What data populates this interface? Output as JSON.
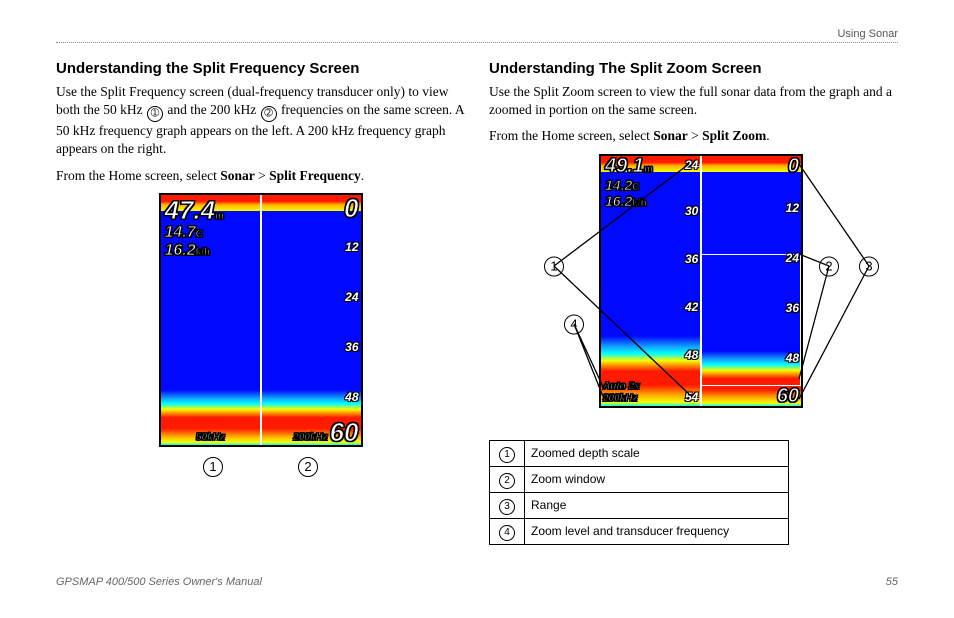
{
  "header_right": "Using Sonar",
  "left": {
    "title": "Understanding the Split Frequency Screen",
    "para_a": "Use the Split Frequency screen (dual-frequency transducer only) to view both the 50 kHz ",
    "para_b": " and the 200 kHz ",
    "para_c": " frequencies on the same screen. A 50 kHz frequency graph appears on the left. A 200 kHz frequency graph appears on the right.",
    "nav_a": "From the Home screen, select ",
    "nav_b": "Sonar",
    "nav_c": " > ",
    "nav_d": "Split Frequency",
    "nav_e": ".",
    "sonar": {
      "depth": "47.4",
      "depth_unit": "m",
      "temp": "14.7",
      "temp_unit": "C",
      "speed": "16.2",
      "speed_unit": "k/h",
      "top_right": "0",
      "ticks_right": [
        "12",
        "24",
        "36",
        "48"
      ],
      "bottom_right": "60",
      "left_freq": "50kHz",
      "right_freq": "200kHz"
    },
    "callouts": [
      "1",
      "2"
    ]
  },
  "right": {
    "title": "Understanding The Split Zoom Screen",
    "para": "Use the Split Zoom screen to view the full sonar data from the graph and a zoomed in portion on the same screen.",
    "nav_a": "From the Home screen, select ",
    "nav_b": "Sonar",
    "nav_c": " > ",
    "nav_d": "Split Zoom",
    "nav_e": ".",
    "sonar": {
      "depth": "49.1",
      "depth_unit": "m",
      "temp": "14.2",
      "temp_unit": "C",
      "speed": "16.2",
      "speed_unit": "k/h",
      "top_left_tick": "24",
      "top_right": "0",
      "ticks_left": [
        "30",
        "36",
        "42",
        "48"
      ],
      "ticks_right": [
        "12",
        "24",
        "36",
        "48"
      ],
      "left_bottom_tick": "54",
      "right_bottom": "60",
      "zoom_label_a": "Auto 2x",
      "zoom_label_b": "200kHz"
    },
    "callouts": [
      "1",
      "2",
      "3",
      "4"
    ],
    "legend": [
      {
        "n": "1",
        "text": "Zoomed depth scale"
      },
      {
        "n": "2",
        "text": "Zoom window"
      },
      {
        "n": "3",
        "text": "Range"
      },
      {
        "n": "4",
        "text": "Zoom level and transducer frequency"
      }
    ]
  },
  "footer_left": "GPSMAP 400/500 Series Owner's Manual",
  "footer_right": "55"
}
